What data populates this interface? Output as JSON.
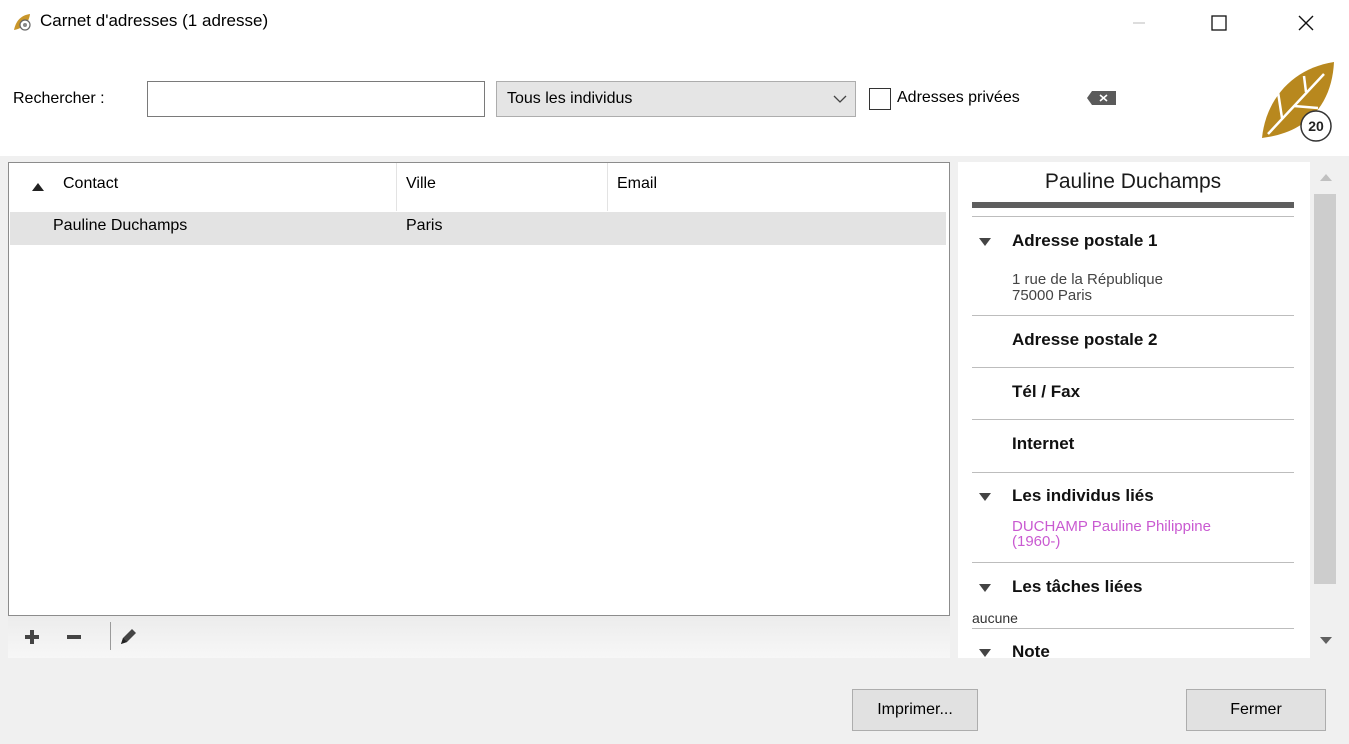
{
  "window": {
    "title": "Carnet d'adresses (1 adresse)"
  },
  "toolbar": {
    "search_label": "Rechercher :",
    "search_value": "",
    "filter_value": "Tous les individus",
    "private_checked": false,
    "private_label": "Adresses privées",
    "logo_text": "20"
  },
  "table": {
    "columns": [
      "Contact",
      "Ville",
      "Email"
    ],
    "sort_column": "Contact",
    "sort_direction": "ascending",
    "rows": [
      {
        "contact": "Pauline Duchamps",
        "ville": "Paris",
        "email": ""
      }
    ]
  },
  "detail": {
    "name": "Pauline Duchamps",
    "sections": {
      "address1": {
        "title": "Adresse postale 1",
        "line1": "1 rue de la République",
        "line2": "75000 Paris"
      },
      "address2": {
        "title": "Adresse postale 2"
      },
      "phone": {
        "title": "Tél / Fax"
      },
      "internet": {
        "title": "Internet"
      },
      "linked_people": {
        "title": "Les individus liés",
        "line1": "DUCHAMP Pauline Philippine",
        "line2": "(1960-)"
      },
      "linked_tasks": {
        "title": "Les tâches liées",
        "value": "aucune"
      },
      "note": {
        "title": "Note"
      }
    }
  },
  "buttons": {
    "print": "Imprimer...",
    "close": "Fermer"
  },
  "colors": {
    "accent_gold": "#b8881e",
    "link_color": "#c95ad1",
    "selected_row": "#e3e3e3"
  }
}
